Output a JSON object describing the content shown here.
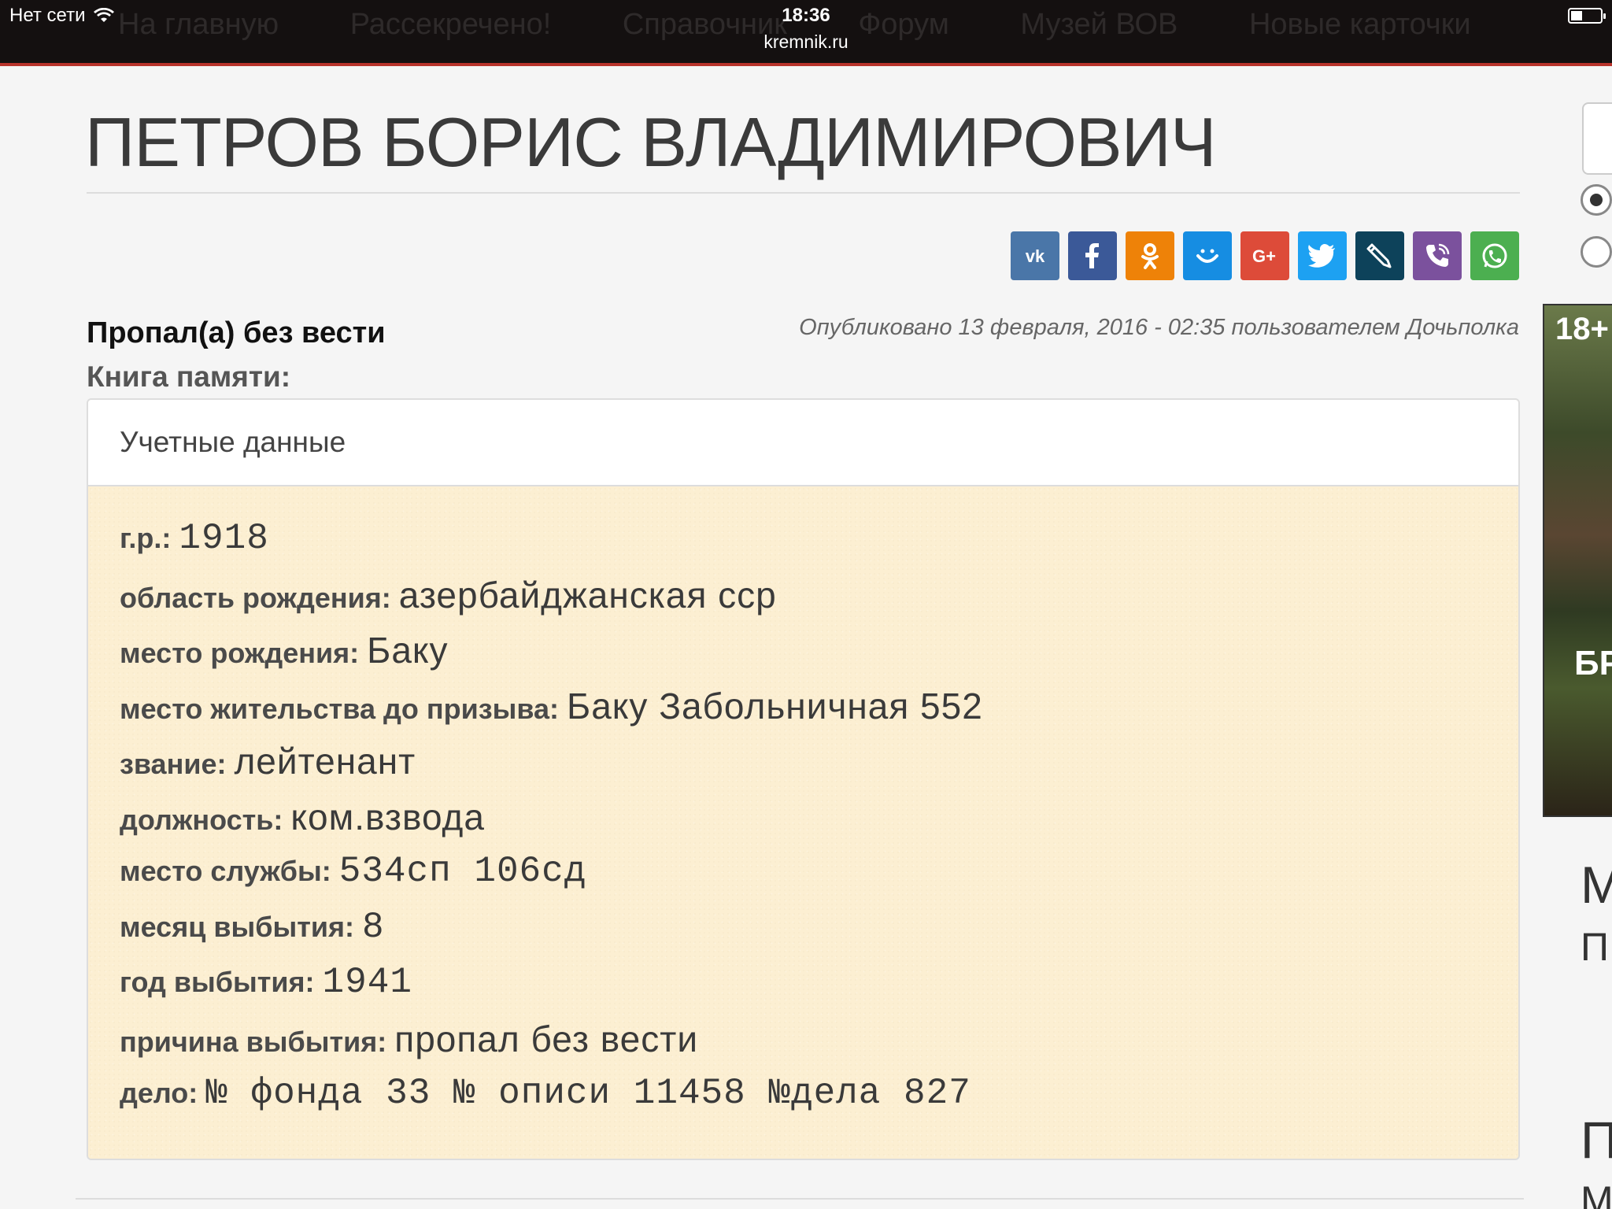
{
  "status_bar": {
    "network": "Нет сети",
    "time": "18:36",
    "url": "kremnik.ru",
    "ghost_nav": [
      "На главную",
      "Рассекречено!",
      "Справочник",
      "Форум",
      "Музей ВОВ",
      "Новые карточки"
    ]
  },
  "page": {
    "title": "ПЕТРОВ БОРИС ВЛАДИМИРОВИЧ",
    "status": "Пропал(а) без вести",
    "published": "Опубликовано 13 февраля, 2016 - 02:35 пользователем Дочьполка",
    "book_label": "Книга памяти:"
  },
  "share": [
    {
      "name": "vk",
      "color": "#4a76a8",
      "icon": "vk-icon"
    },
    {
      "name": "facebook",
      "color": "#3b5998",
      "icon": "facebook-icon"
    },
    {
      "name": "odnoklassniki",
      "color": "#ee8208",
      "icon": "odnoklassniki-icon"
    },
    {
      "name": "moimir",
      "color": "#168de2",
      "icon": "moimir-icon"
    },
    {
      "name": "googleplus",
      "color": "#dd4b39",
      "icon": "google-plus-icon"
    },
    {
      "name": "twitter",
      "color": "#1da1f2",
      "icon": "twitter-icon"
    },
    {
      "name": "livejournal",
      "color": "#0d425a",
      "icon": "livejournal-icon"
    },
    {
      "name": "viber",
      "color": "#7b519d",
      "icon": "viber-icon"
    },
    {
      "name": "whatsapp",
      "color": "#4caf50",
      "icon": "whatsapp-icon"
    }
  ],
  "panel": {
    "heading": "Учетные данные",
    "fields": [
      {
        "label": "г.р.:",
        "value": "1918"
      },
      {
        "label": "область рождения:",
        "value": "азербайджанская  сср"
      },
      {
        "label": "место рождения:",
        "value": "Баку"
      },
      {
        "label": "место жительства до призыва:",
        "value": "Баку  Забольничная  552"
      },
      {
        "label": "звание:",
        "value": "лейтенант"
      },
      {
        "label": "должность:",
        "value": "ком.взвода"
      },
      {
        "label": "место службы:",
        "value": "534сп  106сд"
      },
      {
        "label": "месяц выбытия:",
        "value": "8"
      },
      {
        "label": "год выбытия:",
        "value": "1941"
      },
      {
        "label": "причина выбытия:",
        "value": "пропал  без  вести"
      },
      {
        "label": "дело:",
        "value": "№  фонда  33  №  описи  11458  №дела  827"
      }
    ]
  },
  "sidebar": {
    "ad_age": "18+",
    "ad_text": "БР",
    "fragment_1": "М",
    "fragment_2": "П",
    "fragment_3": "П",
    "fragment_4": "М"
  }
}
